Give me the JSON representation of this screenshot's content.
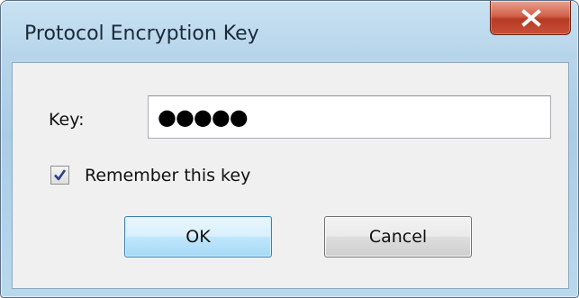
{
  "dialog": {
    "title": "Protocol Encryption Key",
    "close_icon": "close-x-icon"
  },
  "form": {
    "key_label": "Key:",
    "key_value_masked": "●●●●●",
    "remember_label": "Remember this key",
    "remember_checked": true
  },
  "buttons": {
    "ok_label": "OK",
    "cancel_label": "Cancel"
  },
  "colors": {
    "title_bar": "#b7d5ea",
    "close_button": "#c8503a",
    "client_area": "#f0f0f0",
    "default_button": "#bee6fd"
  }
}
